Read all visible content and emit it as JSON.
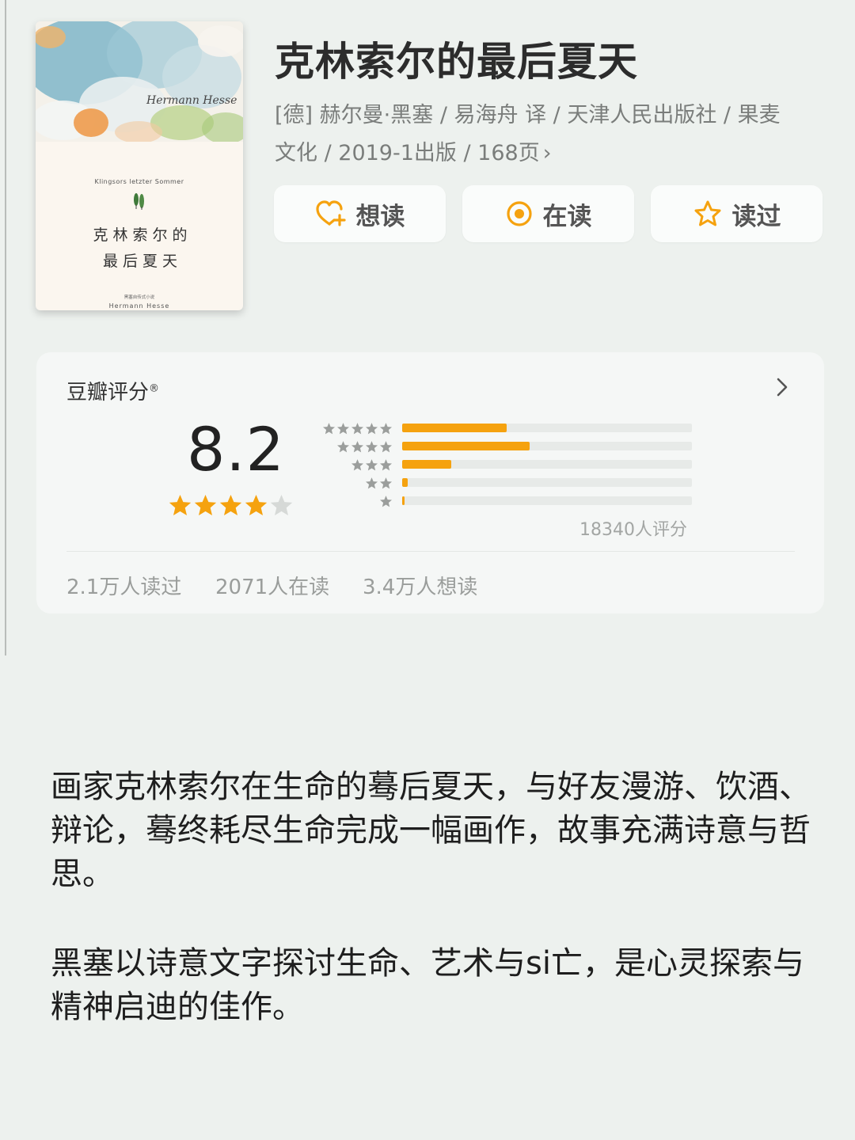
{
  "cover": {
    "signature": "Hermann Hesse",
    "en_title": "Klingsors letzter Sommer",
    "cn_title_line1": "克林索尔的",
    "cn_title_line2": "最后夏天",
    "series": "黑塞自传式小说",
    "author_en": "Hermann Hesse"
  },
  "book": {
    "title": "克林索尔的最后夏天",
    "meta_line1": "[德] 赫尔曼·黑塞 / 易海舟 译 / 天津人民出版社 / 果麦",
    "meta_line2": "文化 / 2019-1出版 / 168页",
    "meta_chevron": "›"
  },
  "actions": {
    "want": "想读",
    "reading": "在读",
    "read": "读过"
  },
  "rating": {
    "title": "豆瓣评分",
    "registered_mark": "®",
    "score": "8.2",
    "stars_filled": 4,
    "stars_total": 5,
    "distribution": [
      {
        "stars": 5,
        "fraction": 0.36
      },
      {
        "stars": 4,
        "fraction": 0.44
      },
      {
        "stars": 3,
        "fraction": 0.17
      },
      {
        "stars": 2,
        "fraction": 0.02
      },
      {
        "stars": 1,
        "fraction": 0.005
      }
    ],
    "count": "18340人评分",
    "read_count": "2.1万人读过",
    "reading_count": "2071人在读",
    "want_count": "3.4万人想读"
  },
  "colors": {
    "accent": "#f5a20f",
    "star_empty": "#d6d9d7",
    "mini_star": "#9b9e9c",
    "background": "#edf1ee"
  },
  "description": {
    "para1": "画家克林索尔在生命的蓦后夏天，与好友漫游、饮酒、辩论，蓦终耗尽生命完成一幅画作，故事充满诗意与哲思。",
    "para2": "黑塞以诗意文字探讨生命、艺术与si亡，是心灵探索与精神启迪的佳作。"
  }
}
